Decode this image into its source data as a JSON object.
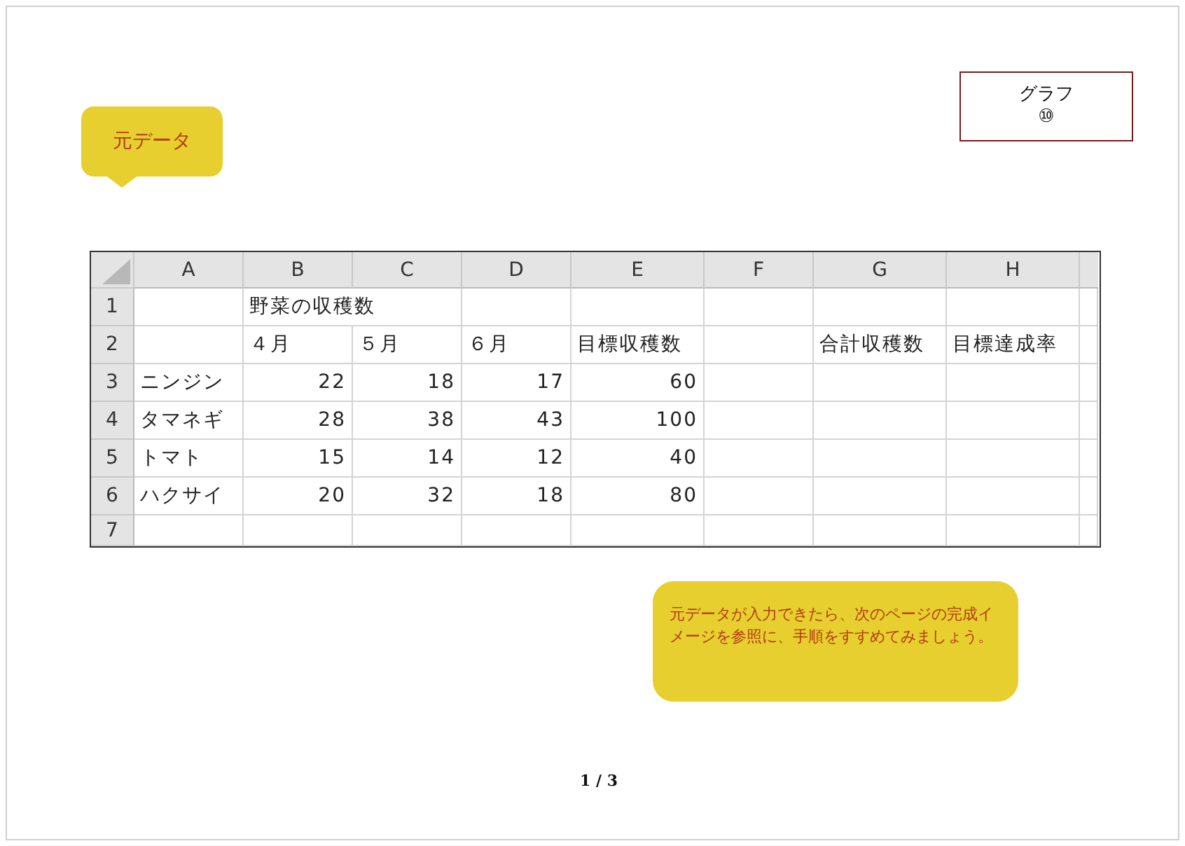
{
  "callout_top": {
    "text": "元データ"
  },
  "label_box": {
    "lines": [
      "グラフ",
      "⑩"
    ]
  },
  "sheet": {
    "columns": [
      "A",
      "B",
      "C",
      "D",
      "E",
      "F",
      "G",
      "H"
    ],
    "rows": [
      {
        "number": "1",
        "cells": {
          "B": {
            "text": "野菜の収穫数"
          }
        }
      },
      {
        "number": "2",
        "cells": {
          "B": {
            "text": "４月"
          },
          "C": {
            "text": "５月"
          },
          "D": {
            "text": "６月"
          },
          "E": {
            "text": "目標収穫数"
          },
          "G": {
            "text": "合計収穫数"
          },
          "H": {
            "text": "目標達成率"
          }
        }
      },
      {
        "number": "3",
        "cells": {
          "A": {
            "text": "ニンジン"
          },
          "B": {
            "text": "22",
            "kind": "number"
          },
          "C": {
            "text": "18",
            "kind": "number"
          },
          "D": {
            "text": "17",
            "kind": "number"
          },
          "E": {
            "text": "60",
            "kind": "number"
          }
        }
      },
      {
        "number": "4",
        "cells": {
          "A": {
            "text": "タマネギ"
          },
          "B": {
            "text": "28",
            "kind": "number"
          },
          "C": {
            "text": "38",
            "kind": "number"
          },
          "D": {
            "text": "43",
            "kind": "number"
          },
          "E": {
            "text": "100",
            "kind": "number"
          }
        }
      },
      {
        "number": "5",
        "cells": {
          "A": {
            "text": "トマト"
          },
          "B": {
            "text": "15",
            "kind": "number"
          },
          "C": {
            "text": "14",
            "kind": "number"
          },
          "D": {
            "text": "12",
            "kind": "number"
          },
          "E": {
            "text": "40",
            "kind": "number"
          }
        }
      },
      {
        "number": "6",
        "cells": {
          "A": {
            "text": "ハクサイ"
          },
          "B": {
            "text": "20",
            "kind": "number"
          },
          "C": {
            "text": "32",
            "kind": "number"
          },
          "D": {
            "text": "18",
            "kind": "number"
          },
          "E": {
            "text": "80",
            "kind": "number"
          }
        }
      },
      {
        "number": "7",
        "cells": {}
      }
    ]
  },
  "callout_bottom": {
    "text": "元データが入力できたら、次のページの完成イメージを参照に、手順をすすめてみましょう。"
  },
  "page_indicator": {
    "current": "1",
    "separator": "/",
    "total": "3"
  }
}
